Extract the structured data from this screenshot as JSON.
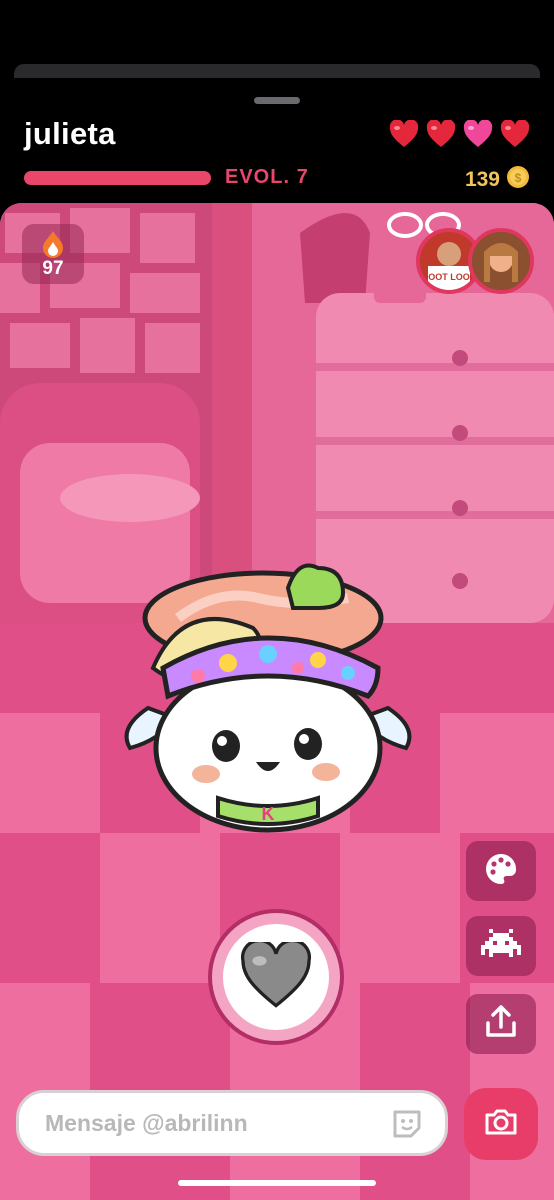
{
  "header": {
    "username": "julieta",
    "evolution_label": "EVOL. 7",
    "coins": "139",
    "hearts": [
      {
        "type": "red"
      },
      {
        "type": "red"
      },
      {
        "type": "pink"
      },
      {
        "type": "red"
      }
    ]
  },
  "scene": {
    "streak_count": "97",
    "streak_icon": "flame-icon",
    "pet_badge_letter": "K",
    "friends_badge_text": "FROOT LOOPS"
  },
  "controls": {
    "love_icon": "heart-icon",
    "side_buttons": [
      "palette-icon",
      "space-invader-icon",
      "share-icon"
    ],
    "message_placeholder": "Mensaje @abrilinn",
    "sticker_icon": "sticker-icon",
    "camera_icon": "camera-icon"
  },
  "colors": {
    "accent": "#e8466a",
    "coin": "#f2c45a",
    "scene_pink": "#e25b8f",
    "camera": "#e83d68"
  }
}
